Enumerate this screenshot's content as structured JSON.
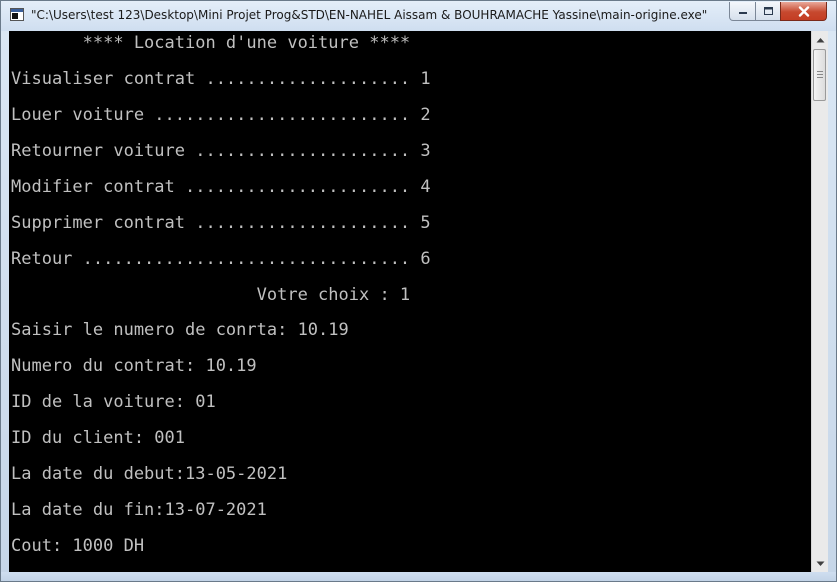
{
  "window": {
    "title": "\"C:\\Users\\test 123\\Desktop\\Mini Projet Prog&STD\\EN-NAHEL Aissam & BOUHRAMACHE Yassine\\main-origine.exe\"",
    "icon": "console-app-icon",
    "controls": {
      "minimize": "minimize-icon",
      "maximize": "maximize-icon",
      "close": "close-icon"
    }
  },
  "console": {
    "text_color": "#c0c0c0",
    "background": "#000000",
    "header": "       **** Location d'une voiture ****",
    "menu": [
      "Visualiser contrat .................... 1",
      "Louer voiture ......................... 2",
      "Retourner voiture ..................... 3",
      "Modifier contrat ...................... 4",
      "Supprimer contrat ..................... 5",
      "Retour ................................ 6"
    ],
    "choice": "                        Votre choix : 1",
    "output": [
      "Saisir le numero de conrta: 10.19",
      "Numero du contrat: 10.19",
      "ID de la voiture: 01",
      "ID du client: 001",
      "La date du debut:13-05-2021",
      "La date du fin:13-07-2021",
      "Cout: 1000 DH"
    ]
  }
}
